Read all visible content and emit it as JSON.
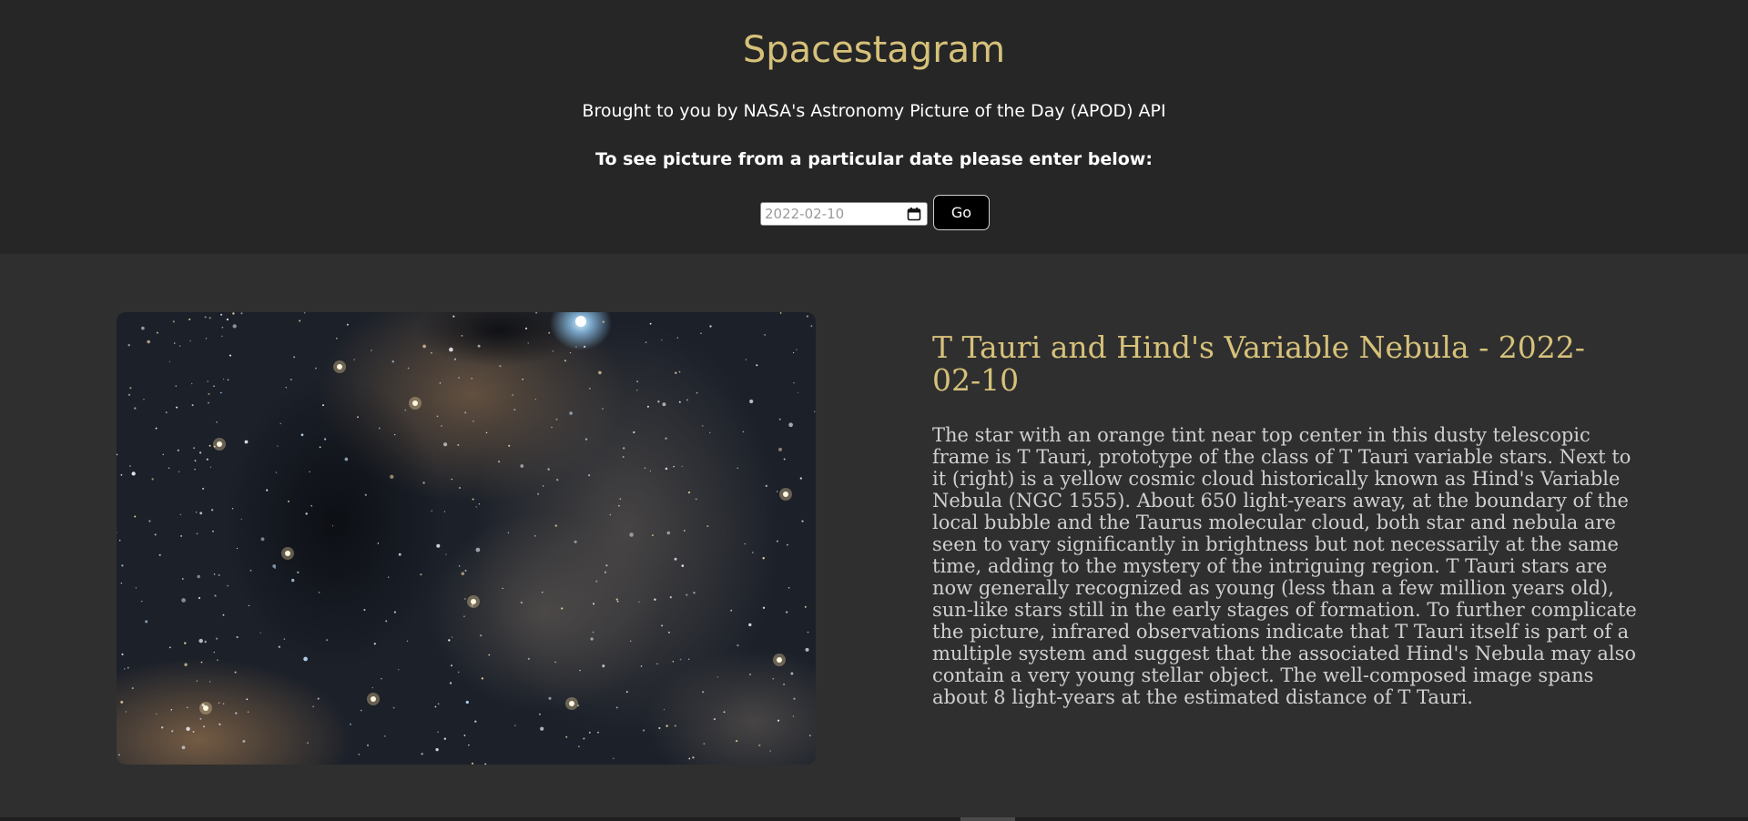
{
  "header": {
    "title": "Spacestagram",
    "subtitle": "Brought to you by NASA's Astronomy Picture of the Day (APOD) API",
    "prompt": "To see picture from a particular date please enter below:",
    "date_value": "2022-02-10",
    "go_label": "Go"
  },
  "apod": {
    "title": "T Tauri and Hind's Variable Nebula - 2022-02-10",
    "description": "The star with an orange tint near top center in this dusty telescopic frame is T Tauri, prototype of the class of T Tauri variable stars. Next to it (right) is a yellow cosmic cloud historically known as Hind's Variable Nebula (NGC 1555). About 650 light-years away, at the boundary of the local bubble and the Taurus molecular cloud, both star and nebula are seen to vary significantly in brightness but not necessarily at the same time, adding to the mystery of the intriguing region. T Tauri stars are now generally recognized as young (less than a few million years old), sun-like stars still in the early stages of formation. To further complicate the picture, infrared observations indicate that T Tauri itself is part of a multiple system and suggest that the associated Hind's Nebula may also contain a very young stellar object. The well-composed image spans about 8 light-years at the estimated distance of T Tauri."
  },
  "colors": {
    "accent": "#d6c17a",
    "header_bg": "#262626",
    "page_bg": "#2f2f2f",
    "body_text": "#cfcfcf"
  },
  "icons": {
    "date_picker": "calendar-icon"
  }
}
